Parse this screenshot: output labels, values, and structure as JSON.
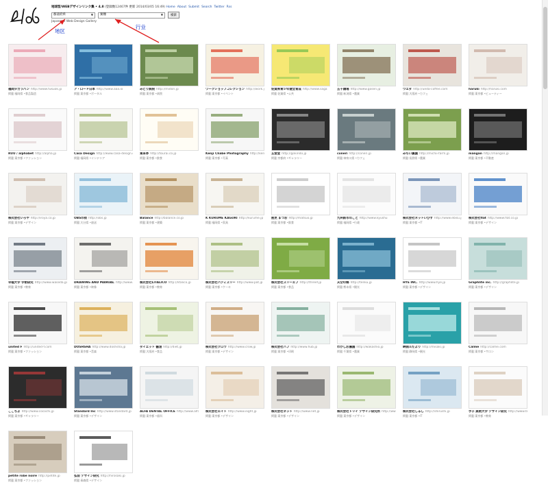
{
  "logo": {
    "text": "486"
  },
  "header": {
    "line1_strong": "地球型/WEBデザインリンク集 • 4.8",
    "line1_rest": "(登録数12467件 更新 2014/03/05 16:49)",
    "links": [
      "Home",
      "About",
      "Submit",
      "Search",
      "Twitter",
      "Rss"
    ],
    "region_select": "都道府県",
    "industry_select": "業種",
    "button": "検索",
    "tagline": "Japanese Web Design Gallery"
  },
  "annotations": {
    "region": "地区",
    "industry": "行业"
  },
  "sites": [
    {
      "title": "福岡タカラパン",
      "url": "http://www.fukuok.jp",
      "sub": "掲載:福岡県 •食品製造",
      "bg": "#f7ecee",
      "accent": "#e89aaa"
    },
    {
      "title": "ア・ロード日本",
      "url": "http://www.aaa.io",
      "sub": "掲載:東京都 •ポータル",
      "bg": "#2f6fa6",
      "accent": "#9bd2ec"
    },
    {
      "title": "みどり病院",
      "url": "http://midori.jp",
      "sub": "掲載:東京都 •病院",
      "bg": "#6c8a4e",
      "accent": "#cfe0b6"
    },
    {
      "title": "ワークショップコレクション",
      "url": "http://work.jp",
      "sub": "掲載:東京都 •イベント",
      "bg": "#f6f1e2",
      "accent": "#e0513a"
    },
    {
      "title": "佐賀県青少年健全育成",
      "url": "http://www.saga",
      "sub": "掲載:佐賀県 •公共",
      "bg": "#f6e874",
      "accent": "#7fc14f"
    },
    {
      "title": "五千鶏場",
      "url": "http://www.gosen.jp",
      "sub": "掲載:新潟県 •農業",
      "bg": "#e7efe2",
      "accent": "#7d6a4d"
    },
    {
      "title": "ウエダ",
      "url": "http://ueda-coffee.com",
      "sub": "掲載:大阪府 •カフェ",
      "bg": "#e8e4dd",
      "accent": "#b3362b"
    },
    {
      "title": "haruki",
      "url": "http://haruki.com",
      "sub": "掲載:東京都 •ビューティー",
      "bg": "#f1eee9",
      "accent": "#c9ada0"
    },
    {
      "title": "RUU / alphabet",
      "url": "http://alpha.jp",
      "sub": "掲載:東京都 •ファッション",
      "bg": "#fafafa",
      "accent": "#d8c2c4"
    },
    {
      "title": "Casa Design",
      "url": "http://www.casa-design.co",
      "sub": "掲載:福岡県 •インテリア",
      "bg": "#f8f8f5",
      "accent": "#a3b474"
    },
    {
      "title": "東来亭",
      "url": "http://tourai.co.jp",
      "sub": "掲載:東京都 •飲食",
      "bg": "#fffdf5",
      "accent": "#d9b37f"
    },
    {
      "title": "Kenji Chabe Photography",
      "url": "http://kenjichabe",
      "sub": "掲載:東京都 •写真",
      "bg": "#f7f7f7",
      "accent": "#7f9b62"
    },
    {
      "title": "五金堂",
      "url": "http://gokindo.jp",
      "sub": "掲載:京都府 •ギャラリー",
      "bg": "#2b2b2b",
      "accent": "#9d9d9d"
    },
    {
      "title": "coneri",
      "url": "http://coneri.jp",
      "sub": "掲載:神奈川県 •カフェ",
      "bg": "#6a7a7f",
      "accent": "#dfe6e4"
    },
    {
      "title": "みちい農園",
      "url": "http://michii-farm.jp",
      "sub": "掲載:長野県 •農業",
      "bg": "#7c9f4e",
      "accent": "#e4efc9"
    },
    {
      "title": "mangan",
      "url": "http://mangan.jp",
      "sub": "掲載:東京都 •不動産",
      "bg": "#1d1d1d",
      "accent": "#8a8a8a"
    },
    {
      "title": "株式会社いろや",
      "url": "http://iroya.co.jp",
      "sub": "掲載:東京都 •デザイン",
      "bg": "#f3f2ef",
      "accent": "#c7b1a1"
    },
    {
      "title": "OBSの街",
      "url": "http://obs.jp",
      "sub": "掲載:大分県 •放送",
      "bg": "#eaf3f8",
      "accent": "#7eb3d4"
    },
    {
      "title": "Balance",
      "url": "http://balance.co.jp",
      "sub": "掲載:東京都 •建築",
      "bg": "#e9dec9",
      "accent": "#a87f4a"
    },
    {
      "title": "K KURUME KAGURI",
      "url": "http://kurume.jp",
      "sub": "掲載:福岡県 •家具",
      "bg": "#f7f6f2",
      "accent": "#bba37c"
    },
    {
      "title": "割烹 まつお",
      "url": "http://matsuo.jp",
      "sub": "掲載:東京都 •飲食",
      "bg": "#ffffff",
      "accent": "#c2c2c2"
    },
    {
      "title": "九州新市のこと",
      "url": "http://www.kyushu",
      "sub": "掲載:福岡県 •行政",
      "bg": "#fcfcfc",
      "accent": "#dcdcdc"
    },
    {
      "title": "株式会社ネットいびす",
      "url": "http://www.ebisu.jp",
      "sub": "掲載:東京都 •IT",
      "bg": "#f3f5f8",
      "accent": "#5d7eaa"
    },
    {
      "title": "株式会社flat",
      "url": "http://www.flat.co.jp",
      "sub": "掲載:東京都 •デザイン",
      "bg": "#fafafa",
      "accent": "#3b78c2"
    },
    {
      "title": "早稲大学 学術研究",
      "url": "http://www.waseda.jp",
      "sub": "掲載:東京都 •教育",
      "bg": "#eceff2",
      "accent": "#525c68"
    },
    {
      "title": "DRAWING AND MANUAL",
      "url": "http://www.drawing.jp",
      "sub": "掲載:東京都 •映像",
      "bg": "#f4f3ef",
      "accent": "#4b4b4b"
    },
    {
      "title": "株式会社LITALICO",
      "url": "http://litalico.jp",
      "sub": "掲載:東京都 •教育",
      "bg": "#f8f5ee",
      "accent": "#e07c2b"
    },
    {
      "title": "株式会社パティスリー",
      "url": "http://www.pat.jp",
      "sub": "掲載:東京都 •ケーキ",
      "bg": "#f0f2e8",
      "accent": "#9cb36c"
    },
    {
      "title": "株式会社スリーエフ",
      "url": "http://threef.jp",
      "sub": "掲載:東京都 •食品",
      "bg": "#7fab45",
      "accent": "#d8ecba"
    },
    {
      "title": "天空の郷",
      "url": "http://tenku.jp",
      "sub": "掲載:熊本県 •観光",
      "bg": "#2a6c92",
      "accent": "#8fc3dc"
    },
    {
      "title": "HYE INC.",
      "url": "http://www.hye.jp",
      "sub": "掲載:東京都 •デザイン",
      "bg": "#ffffff",
      "accent": "#b7b7b7"
    },
    {
      "title": "Graphlite inc.",
      "url": "http://graphlite.jp",
      "sub": "掲載:東京都 •デザイン",
      "bg": "#c7dedb",
      "accent": "#6fa79f"
    },
    {
      "title": "united F",
      "url": "http://united-f.com",
      "sub": "掲載:東京都 •ファッション",
      "bg": "#f7f7f7",
      "accent": "#1e1e1e"
    },
    {
      "title": "DOSHSHA",
      "url": "http://www.doshsha.jp",
      "sub": "掲載:東京都 •音楽",
      "bg": "#f6f0df",
      "accent": "#d6a139"
    },
    {
      "title": "ダイエット 醬油",
      "url": "http://diet.jp",
      "sub": "掲載:大阪府 •食品",
      "bg": "#eef3e3",
      "accent": "#93b35b"
    },
    {
      "title": "株式会社クロウ",
      "url": "http://www.crow.jp",
      "sub": "掲載:東京都 •デザイン",
      "bg": "#f8f6f3",
      "accent": "#c59b6a"
    },
    {
      "title": "株式会社ハブ",
      "url": "http://www.hub.jp",
      "sub": "掲載:東京都 •印刷",
      "bg": "#eef4f2",
      "accent": "#6a9f89"
    },
    {
      "title": "わかしお農園",
      "url": "http://wakashio.jp",
      "sub": "掲載:千葉県 •農業",
      "bg": "#fbfbfb",
      "accent": "#d6d6d6"
    },
    {
      "title": "岬開ルだより",
      "url": "http://misaki.jp",
      "sub": "掲載:静岡県 •観光",
      "bg": "#2aa1a8",
      "accent": "#c8f0ee"
    },
    {
      "title": "Calme",
      "url": "http://calme.com",
      "sub": "掲載:東京都 •サロン",
      "bg": "#f7f7f7",
      "accent": "#a7a7a7"
    },
    {
      "title": "ここちよ",
      "url": "http://www.cocochi.jp",
      "sub": "掲載:東京都 •ギャラリー",
      "bg": "#2c2c2c",
      "accent": "#b23b3b"
    },
    {
      "title": "Standard Inc",
      "url": "http://www.standard.jp",
      "sub": "掲載:東京都 •デザイン",
      "bg": "#5d7892",
      "accent": "#dfe7ee"
    },
    {
      "title": "ALFA DENTAL OFFICE",
      "url": "http://www.alfa",
      "sub": "掲載:東京都 •歯科",
      "bg": "#f5f5f5",
      "accent": "#c7d3da"
    },
    {
      "title": "株式会社エイト",
      "url": "http://www.eight.jp",
      "sub": "掲載:東京都 •デザイン",
      "bg": "#f4efe7",
      "accent": "#d4b187"
    },
    {
      "title": "株式会社ネット",
      "url": "http://www.net.jp",
      "sub": "掲載:東京都 •デザイン",
      "bg": "#e4e1dc",
      "accent": "#5b5b5b"
    },
    {
      "title": "株式会社トリイ デザイン研究所",
      "url": "http://www.torii",
      "sub": "掲載:東京都 •デザイン",
      "bg": "#eef2e6",
      "accent": "#84a954"
    },
    {
      "title": "株式会社しるし",
      "url": "http://shirushi.jp",
      "sub": "掲載:東京都 •IT",
      "bg": "#dbe8f1",
      "accent": "#5b8fb8"
    },
    {
      "title": "手子 美術大学 デザイン研究",
      "url": "http://www.teko",
      "sub": "掲載:東京都 •教育",
      "bg": "#fbfbfb",
      "accent": "#d7c8b7"
    },
    {
      "title": "petite robe noire",
      "url": "http://petite.jp",
      "sub": "掲載:東京都 •ファッション",
      "bg": "#d7cdbd",
      "accent": "#8a7b66"
    },
    {
      "title": "弘前 デザイン研究",
      "url": "http://hirosaki.jp",
      "sub": "掲載:青森県 •デザイン",
      "bg": "#ffffff",
      "accent": "#333333"
    }
  ]
}
